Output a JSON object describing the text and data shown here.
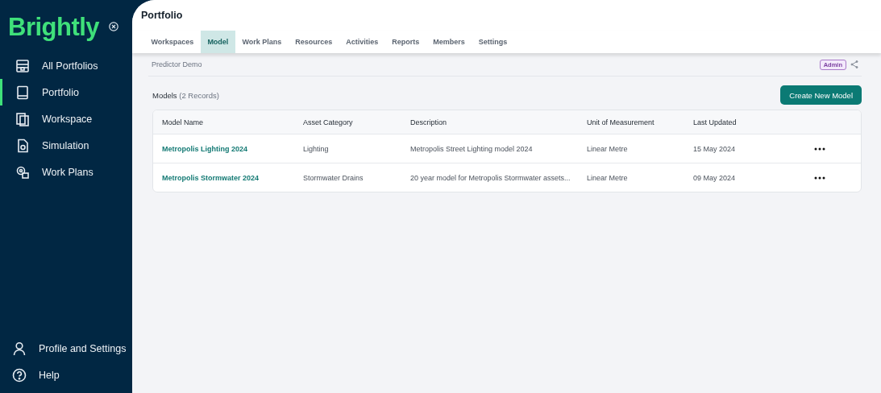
{
  "sidebar": {
    "logo": "Brightly",
    "nav": [
      {
        "label": "All Portfolios",
        "selected": false
      },
      {
        "label": "Portfolio",
        "selected": true
      },
      {
        "label": "Workspace",
        "selected": false
      },
      {
        "label": "Simulation",
        "selected": false
      },
      {
        "label": "Work Plans",
        "selected": false
      }
    ],
    "bottom": [
      {
        "label": "Profile and Settings"
      },
      {
        "label": "Help"
      }
    ]
  },
  "header": {
    "title": "Portfolio"
  },
  "tabs": [
    {
      "label": "Workspaces",
      "selected": false
    },
    {
      "label": "Model",
      "selected": true
    },
    {
      "label": "Work Plans",
      "selected": false
    },
    {
      "label": "Resources",
      "selected": false
    },
    {
      "label": "Activities",
      "selected": false
    },
    {
      "label": "Reports",
      "selected": false
    },
    {
      "label": "Members",
      "selected": false
    },
    {
      "label": "Settings",
      "selected": false
    }
  ],
  "breadcrumb": "Predictor Demo",
  "role_badge": "Admin",
  "models": {
    "title": "Models",
    "count": "(2 Records)",
    "create_button": "Create New Model",
    "columns": [
      "Model Name",
      "Asset Category",
      "Description",
      "Unit of Measurement",
      "Last Updated"
    ],
    "rows": [
      {
        "name": "Metropolis Lighting 2024",
        "category": "Lighting",
        "description": "Metropolis Street Lighting model 2024",
        "unit": "Linear Metre",
        "updated": "15 May 2024"
      },
      {
        "name": "Metropolis Stormwater 2024",
        "category": "Stormwater Drains",
        "description": "20 year model for Metropolis Stormwater assets...",
        "unit": "Linear Metre",
        "updated": "09 May 2024"
      }
    ]
  }
}
